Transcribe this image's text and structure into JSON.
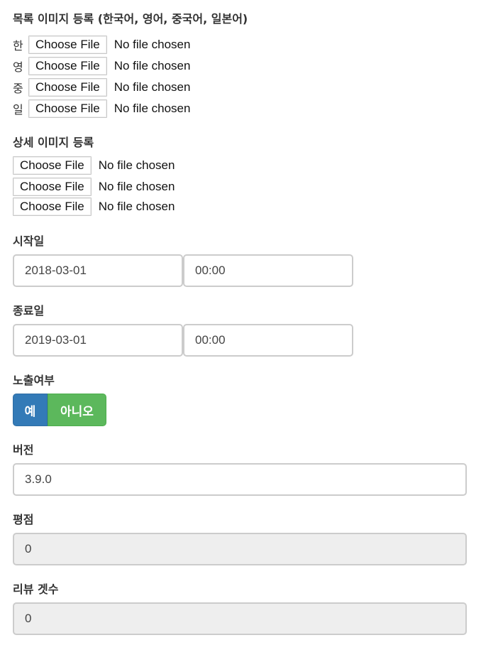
{
  "list_images": {
    "label": "목록 이미지 등록 (한국어, 영어, 중국어, 일본어)",
    "rows": [
      {
        "lang": "한",
        "button": "Choose File",
        "status": "No file chosen"
      },
      {
        "lang": "영",
        "button": "Choose File",
        "status": "No file chosen"
      },
      {
        "lang": "중",
        "button": "Choose File",
        "status": "No file chosen"
      },
      {
        "lang": "일",
        "button": "Choose File",
        "status": "No file chosen"
      }
    ]
  },
  "detail_images": {
    "label": "상세 이미지 등록",
    "rows": [
      {
        "button": "Choose File",
        "status": "No file chosen"
      },
      {
        "button": "Choose File",
        "status": "No file chosen"
      },
      {
        "button": "Choose File",
        "status": "No file chosen"
      }
    ]
  },
  "start": {
    "label": "시작일",
    "date": "2018-03-01",
    "time": "00:00"
  },
  "end": {
    "label": "종료일",
    "date": "2019-03-01",
    "time": "00:00"
  },
  "visibility": {
    "label": "노출여부",
    "yes": "예",
    "no": "아니오"
  },
  "version": {
    "label": "버전",
    "value": "3.9.0"
  },
  "rating": {
    "label": "평점",
    "value": "0"
  },
  "review_count": {
    "label": "리뷰 겟수",
    "value": "0"
  },
  "colors": {
    "yes_button": "#337ab7",
    "no_button": "#5cb85c",
    "readonly_bg": "#eeeeee"
  }
}
